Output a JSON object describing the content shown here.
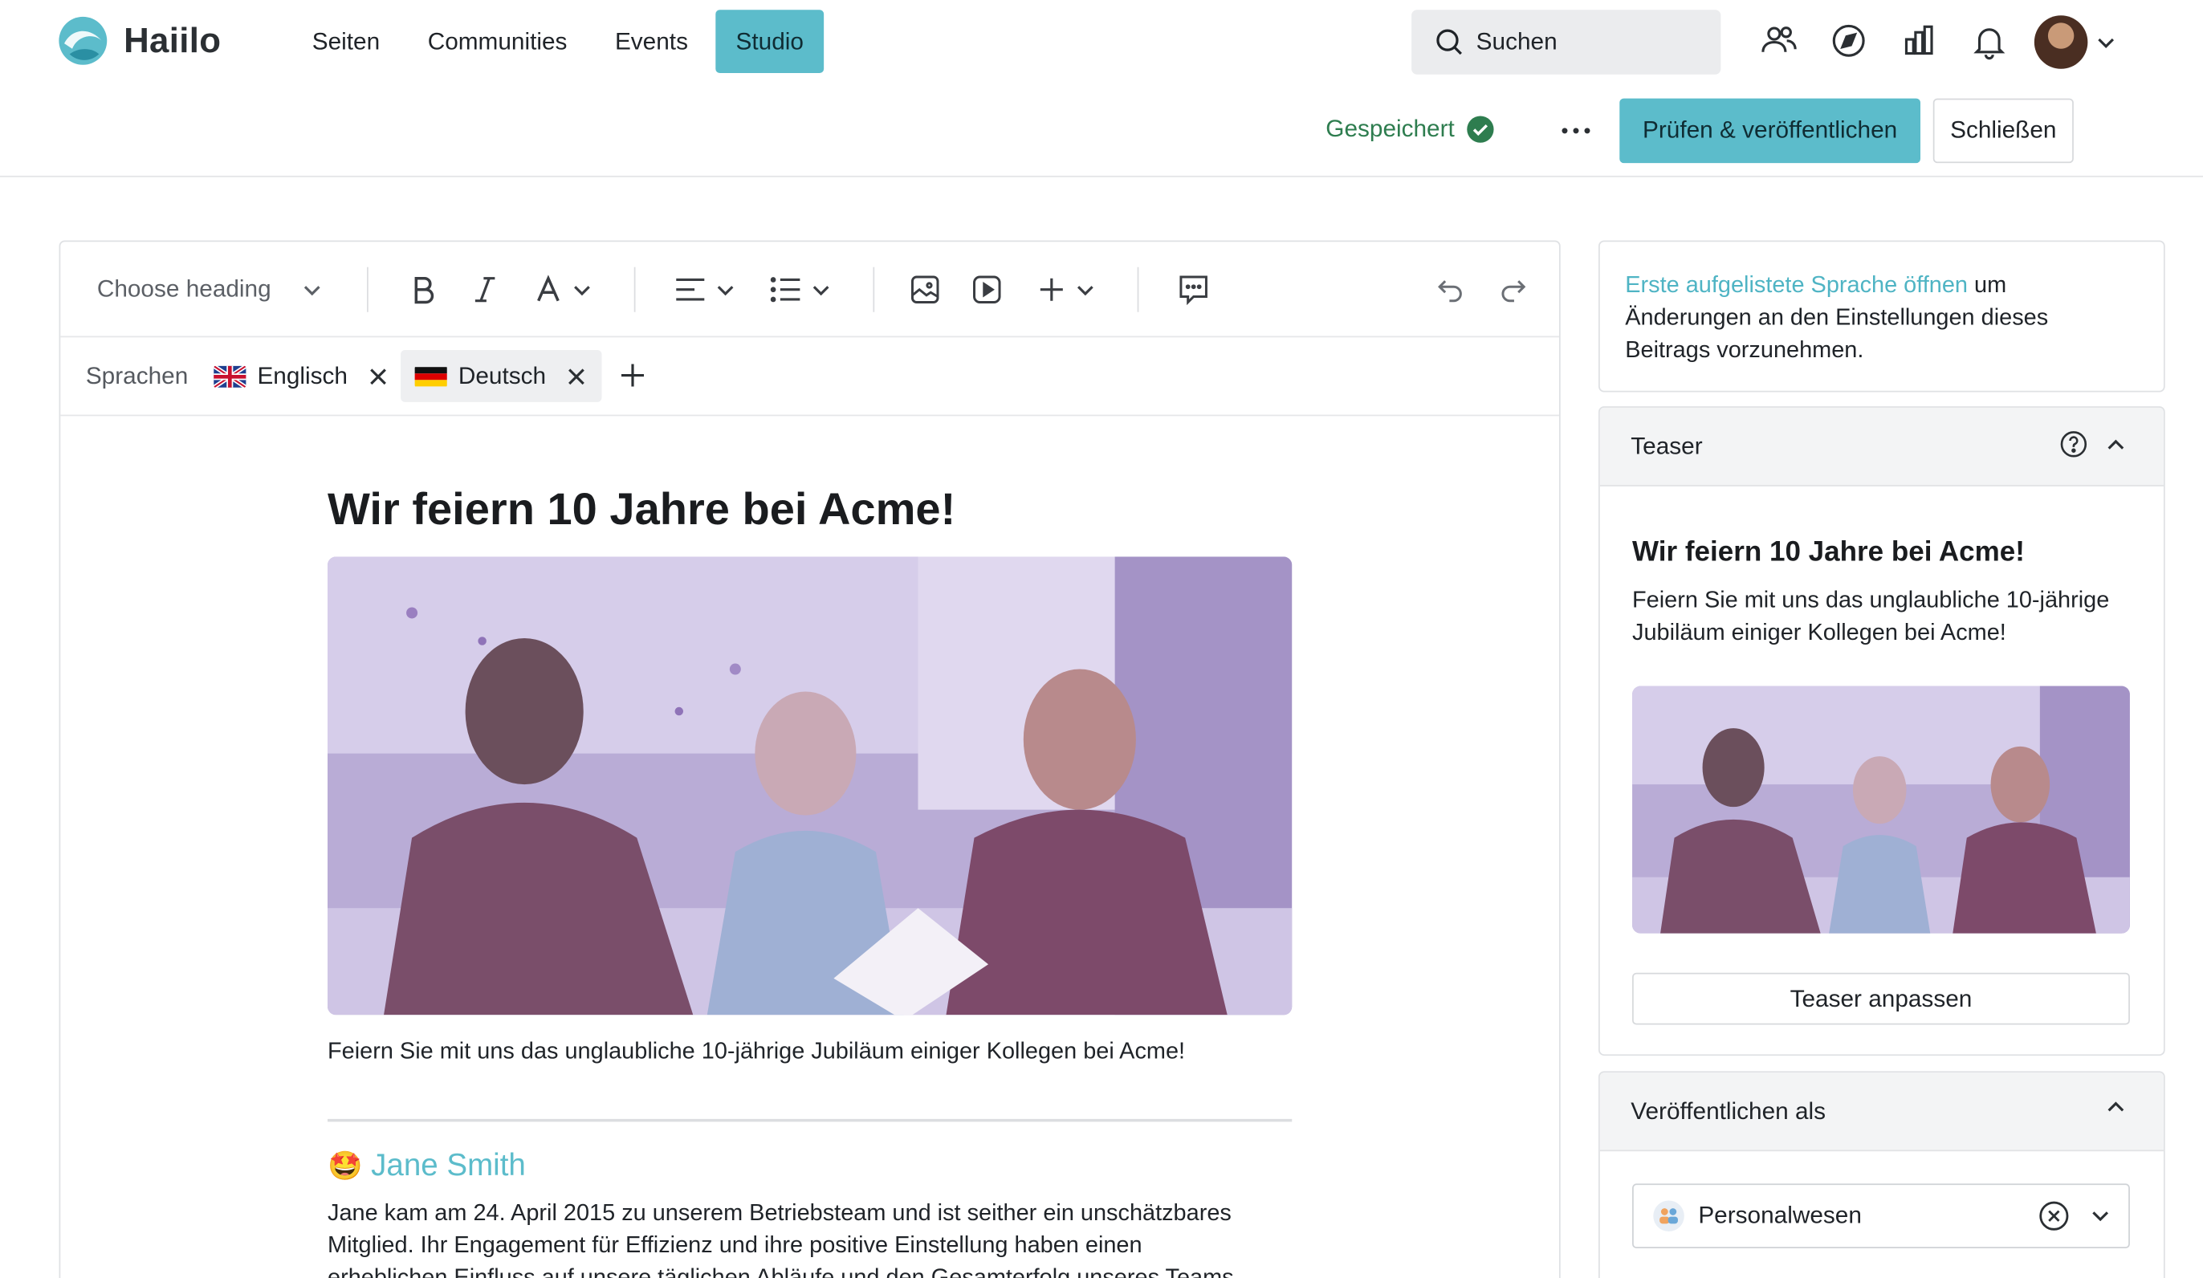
{
  "app": {
    "logo_text": "Haiilo",
    "brand_color": "#5cbccb"
  },
  "nav": {
    "items": [
      {
        "label": "Seiten"
      },
      {
        "label": "Communities"
      },
      {
        "label": "Events"
      },
      {
        "label": "Studio",
        "active": true
      }
    ]
  },
  "search": {
    "placeholder": "Suchen"
  },
  "header_icons": [
    "people-icon",
    "compass-icon",
    "chart-icon",
    "bell-icon",
    "user-avatar"
  ],
  "actions": {
    "status": "Gespeichert",
    "publish_label": "Prüfen & veröffentlichen",
    "close_label": "Schließen"
  },
  "toolbar": {
    "heading_placeholder": "Choose heading",
    "icons": [
      "bold-icon",
      "italic-icon",
      "text-color-icon",
      "align-icon",
      "list-icon",
      "image-icon",
      "video-icon",
      "insert-icon",
      "comment-icon",
      "undo-icon",
      "redo-icon"
    ]
  },
  "languages": {
    "label": "Sprachen",
    "items": [
      {
        "name": "Englisch",
        "flag": "uk-flag-icon",
        "active": false
      },
      {
        "name": "Deutsch",
        "flag": "de-flag-icon",
        "active": true
      }
    ]
  },
  "article": {
    "title": "Wir feiern 10 Jahre bei Acme!",
    "lead": "Feiern Sie mit uns das unglaubliche 10-jährige Jubiläum einiger Kollegen bei Acme!",
    "section_emoji": "🤩",
    "section_name": "Jane Smith",
    "bio_line1": "Jane kam am 24. April 2015 zu unserem Betriebsteam und ist seither ein unschätzbares",
    "bio_line2": "Mitglied. Ihr Engagement für Effizienz und ihre positive Einstellung haben einen",
    "bio_line3": "erheblichen Einfluss auf unsere täglichen Abläufe und den Gesamterfolg unseres Teams"
  },
  "sidebar": {
    "note_link": "Erste aufgelistete Sprache öffnen",
    "note_text": " um Änderungen an den Einstellungen dieses Beitrags vorzunehmen.",
    "teaser": {
      "header": "Teaser",
      "title": "Wir feiern 10 Jahre bei Acme!",
      "text": "Feiern Sie mit uns das unglaubliche 10-jährige Jubiläum einiger Kollegen bei Acme!",
      "button": "Teaser anpassen"
    },
    "publish_as": {
      "header": "Veröffentlichen als",
      "value": "Personalwesen"
    }
  }
}
